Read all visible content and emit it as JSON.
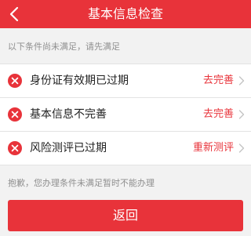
{
  "colors": {
    "brand": "#e8333a",
    "background": "#f2f2f2",
    "muted_text": "#8f8f8f"
  },
  "header": {
    "title": "基本信息检查",
    "back_icon": "chevron-left-icon"
  },
  "hint_text": "以下条件尚未满足，请先满足",
  "conditions": [
    {
      "label": "身份证有效期已过期",
      "action": "去完善",
      "status_icon": "close-circle-icon"
    },
    {
      "label": "基本信息不完善",
      "action": "去完善",
      "status_icon": "close-circle-icon"
    },
    {
      "label": "风险测评已过期",
      "action": "重新测评",
      "status_icon": "close-circle-icon"
    }
  ],
  "notice_text": "抱歉，您办理条件未满足暂时不能办理",
  "return_button_label": "返回"
}
